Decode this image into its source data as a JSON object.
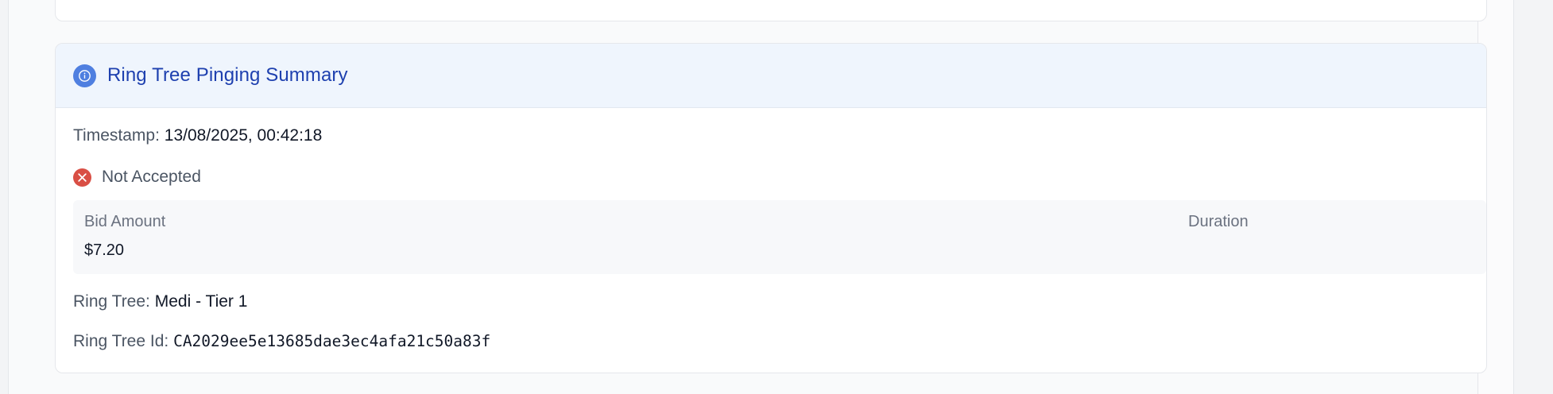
{
  "summary": {
    "title": "Ring Tree Pinging Summary",
    "header_icon": "info-icon",
    "timestamp_label": "Timestamp:",
    "timestamp_value": "13/08/2025, 00:42:18",
    "status_icon": "x-circle-icon",
    "status_text": "Not Accepted",
    "bid_amount_label": "Bid Amount",
    "bid_amount_value": "$7.20",
    "duration_label": "Duration",
    "ring_tree_label": "Ring Tree:",
    "ring_tree_value": "Medi - Tier 1",
    "ring_tree_id_label": "Ring Tree Id:",
    "ring_tree_id_value": "CA2029ee5e13685dae3ec4afa21c50a83f"
  },
  "colors": {
    "header_bg": "#eff5fd",
    "title": "#1e40af",
    "info_icon": "#4f7fe0",
    "error": "#d94f45"
  }
}
